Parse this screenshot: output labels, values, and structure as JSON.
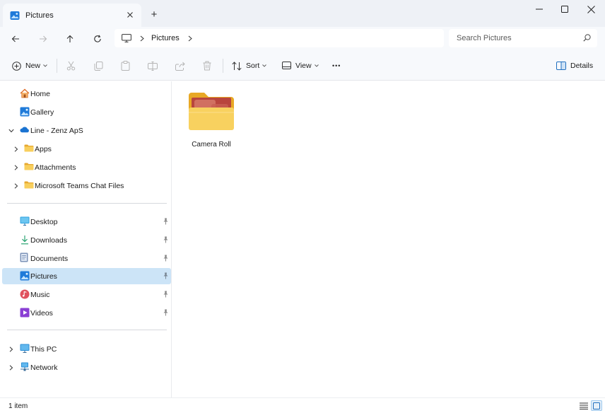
{
  "window": {
    "tab_title": "Pictures",
    "new_tab_glyph": "+"
  },
  "nav": {
    "address_crumb": "Pictures",
    "search_placeholder": "Search Pictures"
  },
  "commands": {
    "new_label": "New",
    "sort_label": "Sort",
    "view_label": "View",
    "details_label": "Details",
    "more_glyph": "•••"
  },
  "sidebar": {
    "quick": [
      {
        "label": "Home",
        "icon": "home-icon"
      },
      {
        "label": "Gallery",
        "icon": "gallery-icon"
      }
    ],
    "cloud": {
      "label": "Line - Zenz ApS",
      "icon": "onedrive-icon",
      "children": [
        "Apps",
        "Attachments",
        "Microsoft Teams Chat Files"
      ]
    },
    "pinned": [
      {
        "label": "Desktop",
        "icon": "desktop-icon"
      },
      {
        "label": "Downloads",
        "icon": "downloads-icon"
      },
      {
        "label": "Documents",
        "icon": "documents-icon"
      },
      {
        "label": "Pictures",
        "icon": "pictures-icon",
        "selected": true
      },
      {
        "label": "Music",
        "icon": "music-icon"
      },
      {
        "label": "Videos",
        "icon": "videos-icon"
      }
    ],
    "bottom": [
      {
        "label": "This PC",
        "icon": "this-pc-icon"
      },
      {
        "label": "Network",
        "icon": "network-icon"
      }
    ]
  },
  "content": {
    "items": [
      {
        "name": "Camera Roll",
        "type": "folder"
      }
    ]
  },
  "status": {
    "item_count": "1 item"
  },
  "colors": {
    "accent": "#0067c0",
    "selected_bg": "#cce4f7",
    "folder_yellow": "#f5c64a",
    "chrome_bg": "#f7f9fc"
  }
}
